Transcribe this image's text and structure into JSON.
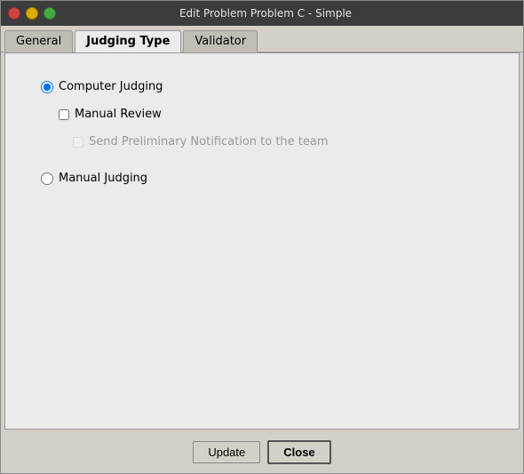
{
  "window": {
    "title": "Edit Problem Problem C - Simple"
  },
  "titlebar": {
    "close_btn": "×",
    "minimize_btn": "−",
    "maximize_btn": "+"
  },
  "tabs": [
    {
      "id": "general",
      "label": "General",
      "active": false
    },
    {
      "id": "judging-type",
      "label": "Judging Type",
      "active": true
    },
    {
      "id": "validator",
      "label": "Validator",
      "active": false
    }
  ],
  "judging_type": {
    "computer_judging_label": "Computer Judging",
    "manual_review_label": "Manual Review",
    "send_notification_label": "Send Preliminary Notification to the team",
    "manual_judging_label": "Manual Judging"
  },
  "buttons": {
    "update_label": "Update",
    "close_label": "Close"
  }
}
